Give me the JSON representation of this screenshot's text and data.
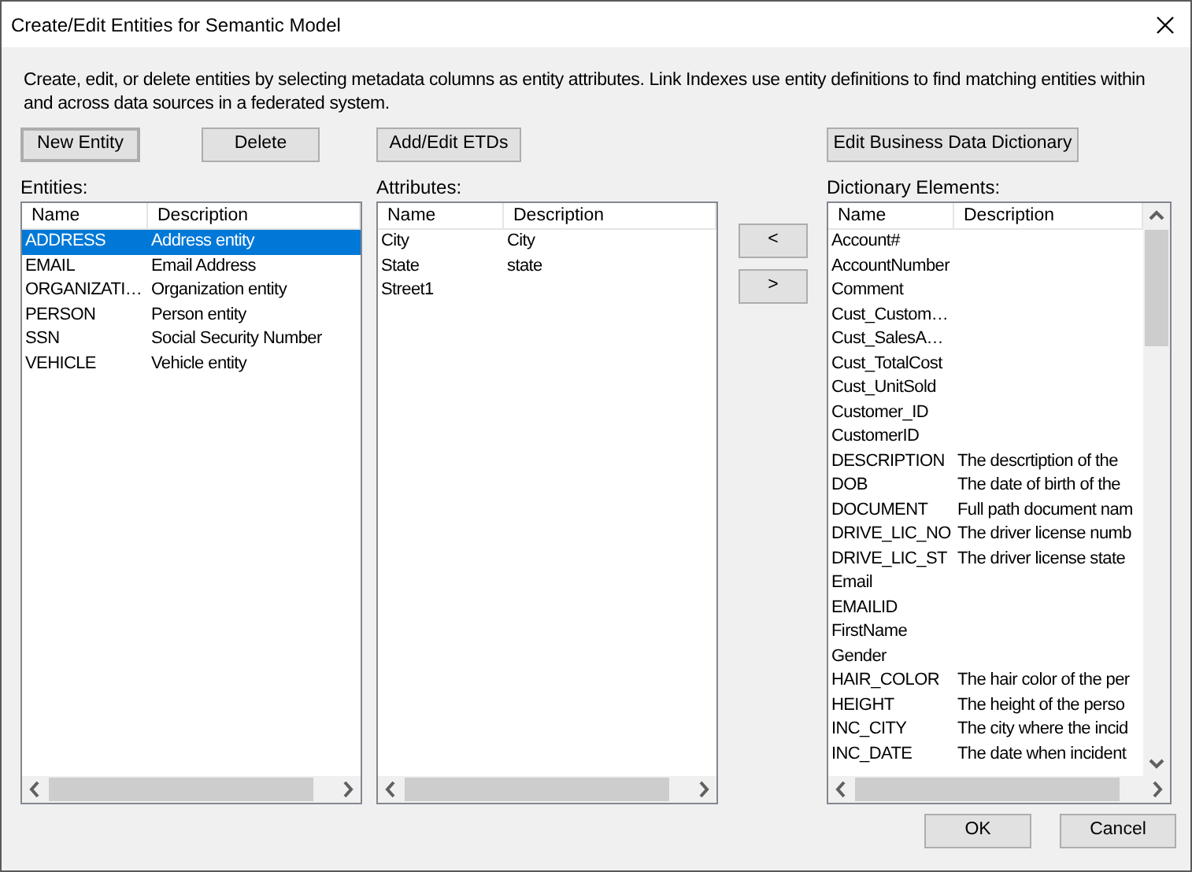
{
  "window": {
    "title": "Create/Edit Entities for Semantic Model"
  },
  "description": "Create, edit, or delete entities by selecting metadata columns as entity attributes. Link Indexes use entity definitions to find matching entities within and across data sources in a federated system.",
  "buttons": {
    "new_entity": "New Entity",
    "delete": "Delete",
    "add_edit_etds": "Add/Edit ETDs",
    "edit_dictionary": "Edit Business Data Dictionary",
    "move_left": "<",
    "move_right": ">",
    "ok": "OK",
    "cancel": "Cancel"
  },
  "entities": {
    "label": "Entities:",
    "columns": [
      "Name",
      "Description"
    ],
    "rows": [
      {
        "name": "ADDRESS",
        "description": "Address entity",
        "selected": true
      },
      {
        "name": "EMAIL",
        "description": "Email Address",
        "selected": false
      },
      {
        "name": "ORGANIZATI…",
        "description": "Organization entity",
        "selected": false
      },
      {
        "name": "PERSON",
        "description": "Person entity",
        "selected": false
      },
      {
        "name": "SSN",
        "description": "Social Security Number",
        "selected": false
      },
      {
        "name": "VEHICLE",
        "description": "Vehicle entity",
        "selected": false
      }
    ]
  },
  "attributes": {
    "label": "Attributes:",
    "columns": [
      "Name",
      "Description"
    ],
    "rows": [
      {
        "name": "City",
        "description": "City",
        "selected": false
      },
      {
        "name": "State",
        "description": "state",
        "selected": false
      },
      {
        "name": "Street1",
        "selected": false
      }
    ]
  },
  "dictionary": {
    "label": "Dictionary Elements:",
    "columns": [
      "Name",
      "Description"
    ],
    "rows": [
      {
        "name": "Account#",
        "selected": false
      },
      {
        "name": "AccountNumber",
        "selected": false
      },
      {
        "name": "Comment",
        "selected": false
      },
      {
        "name": "Cust_Custom…",
        "selected": false
      },
      {
        "name": "Cust_SalesA…",
        "selected": false
      },
      {
        "name": "Cust_TotalCost",
        "selected": false
      },
      {
        "name": "Cust_UnitSold",
        "selected": false
      },
      {
        "name": "Customer_ID",
        "selected": false
      },
      {
        "name": "CustomerID",
        "selected": false
      },
      {
        "name": "DESCRIPTION",
        "description": "The descrtiption of the",
        "selected": false
      },
      {
        "name": "DOB",
        "description": "The date of birth of the",
        "selected": false
      },
      {
        "name": "DOCUMENT",
        "description": "Full path document nam",
        "selected": false
      },
      {
        "name": "DRIVE_LIC_NO",
        "description": "The driver license numb",
        "selected": false
      },
      {
        "name": "DRIVE_LIC_ST",
        "description": "The driver license state",
        "selected": false
      },
      {
        "name": "Email",
        "selected": false
      },
      {
        "name": "EMAILID",
        "selected": false
      },
      {
        "name": "FirstName",
        "selected": false
      },
      {
        "name": "Gender",
        "selected": false
      },
      {
        "name": "HAIR_COLOR",
        "description": "The hair color of the per",
        "selected": false
      },
      {
        "name": "HEIGHT",
        "description": "The height of the perso",
        "selected": false
      },
      {
        "name": "INC_CITY",
        "description": "The city where the incid",
        "selected": false
      },
      {
        "name": "INC_DATE",
        "description": "The date when incident",
        "selected": false
      }
    ]
  }
}
